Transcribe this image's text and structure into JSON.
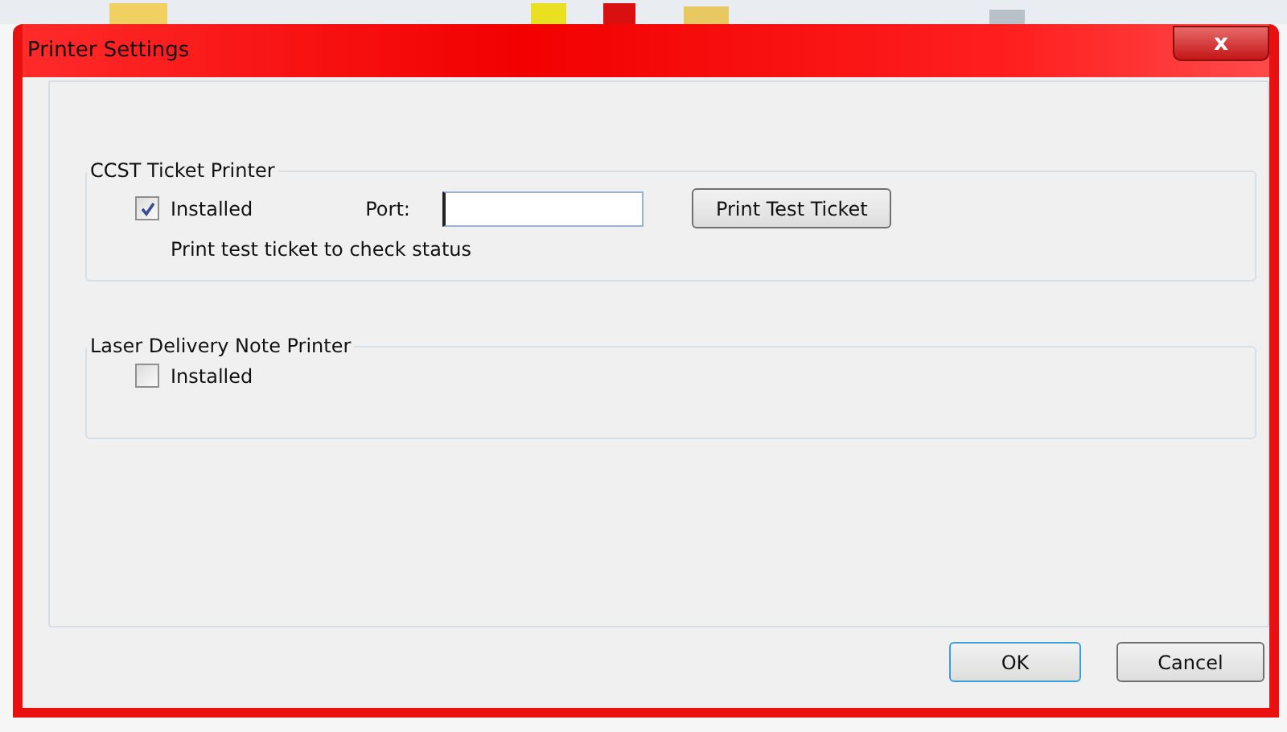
{
  "window": {
    "title": "Printer Settings",
    "close": "x"
  },
  "groups": [
    {
      "title": "CCST Ticket Printer",
      "installed": {
        "label": "Installed",
        "checked": true
      },
      "port": {
        "label": "Port:"
      },
      "button": "Print Test Ticket",
      "hint": "Print test ticket to check status"
    },
    {
      "title": "Laser Delivery Note Printer",
      "installed": {
        "label": "Installed",
        "checked": false
      }
    }
  ],
  "buttons": [
    {
      "label": "OK",
      "default": true
    },
    {
      "label": "Cancel",
      "default": false
    }
  ]
}
